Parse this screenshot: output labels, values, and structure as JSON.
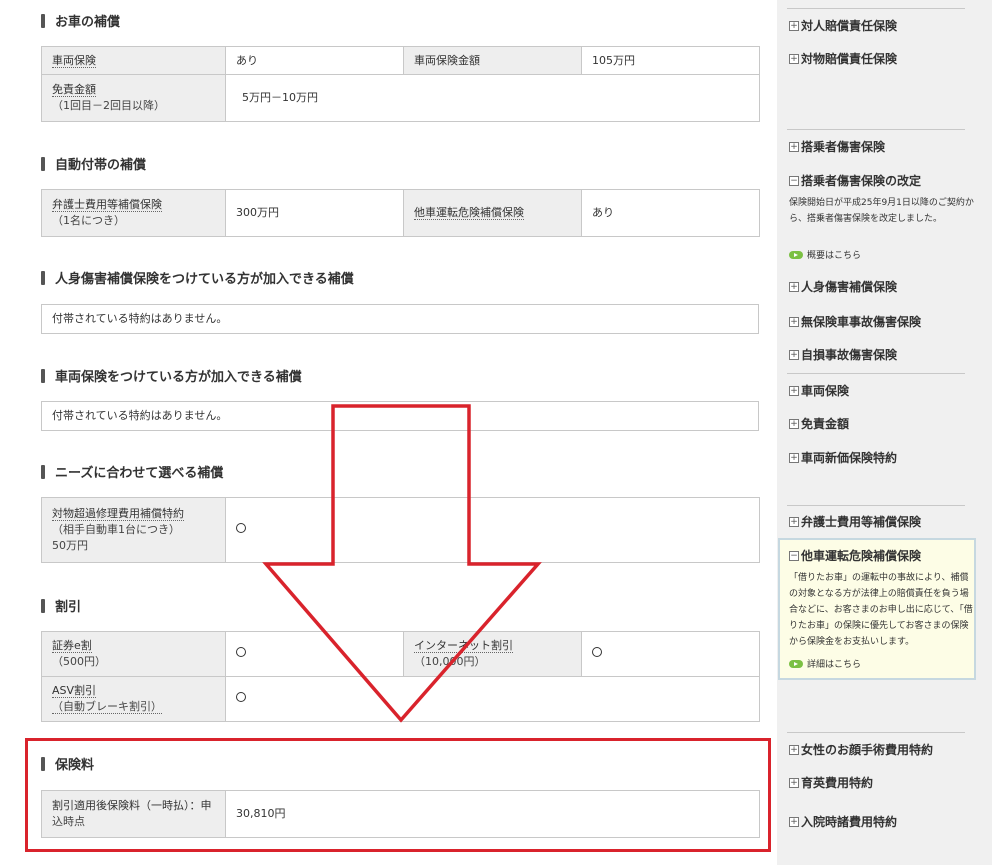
{
  "sections": {
    "car": {
      "title": "お車の補償"
    },
    "auto": {
      "title": "自動付帯の補償"
    },
    "personal": {
      "title": "人身傷害補償保険をつけている方が加入できる補償",
      "notice": "付帯されている特約はありません。"
    },
    "vehicle": {
      "title": "車両保険をつけている方が加入できる補償",
      "notice": "付帯されている特約はありません。"
    },
    "needs": {
      "title": "ニーズに合わせて選べる補償"
    },
    "discount": {
      "title": "割引"
    },
    "premium": {
      "title": "保険料"
    }
  },
  "car_table": {
    "vehicle_ins_label": "車両保険",
    "vehicle_ins_value": "あり",
    "vehicle_amount_label": "車両保険金額",
    "vehicle_amount_value": "105万円",
    "deductible_label": "免責金額",
    "deductible_sub": "（1回目－2回目以降）",
    "deductible_value": "5万円－10万円"
  },
  "auto_table": {
    "lawyer_label": "弁護士費用等補償保険",
    "lawyer_sub": "（1名につき）",
    "lawyer_value": "300万円",
    "other_car_label": "他車運転危険補償保険",
    "other_car_value": "あり"
  },
  "needs_table": {
    "repair_label": "対物超過修理費用補償特約",
    "repair_sub1": "（相手自動車1台につき）",
    "repair_sub2": "50万円",
    "repair_value": "○"
  },
  "discount_table": {
    "cert_label": "証券e割",
    "cert_sub": "（500円）",
    "cert_value": "○",
    "internet_label": "インターネット割引",
    "internet_sub": "（10,000円）",
    "internet_value": "○",
    "asv_label": "ASV割引",
    "asv_sub": "（自動ブレーキ割引）",
    "asv_value": "○"
  },
  "premium_table": {
    "label_line1": "割引適用後保険料（一時払）：申",
    "label_line2": "込時点",
    "value": "30,810円"
  },
  "sidebar": {
    "items": {
      "bodily": "対人賠償責任保険",
      "property": "対物賠償責任保険",
      "passenger": "搭乗者傷害保険",
      "passenger_rev": "搭乗者傷害保険の改定",
      "passenger_rev_desc": "保険開始日が平成25年9月1日以降のご契約から、搭乗者傷害保険を改定しました。",
      "passenger_rev_link": "概要はこちら",
      "personal_injury": "人身傷害補償保険",
      "uninsured": "無保険車事故傷害保険",
      "self_accident": "自損事故傷害保険",
      "vehicle": "車両保険",
      "deductible": "免責金額",
      "new_car": "車両新価保険特約",
      "lawyer": "弁護士費用等補償保険",
      "other_car": "他車運転危険補償保険",
      "other_car_desc": "「借りたお車」の運転中の事故により、補償の対象となる方が法律上の賠償責任を負う場合などに、お客さまのお申し出に応じて、「借りたお車」の保険に優先してお客さまの保険から保険金をお支払いします。",
      "other_car_link": "詳細はこちら",
      "facial": "女性のお顔手術費用特約",
      "childcare": "育英費用特約",
      "hospital": "入院時諸費用特約"
    }
  },
  "colors": {
    "red_accent": "#d9232c",
    "label_bg": "#eeeeee",
    "highlight_bg": "#fdfde6",
    "link_green": "#7bc043"
  }
}
